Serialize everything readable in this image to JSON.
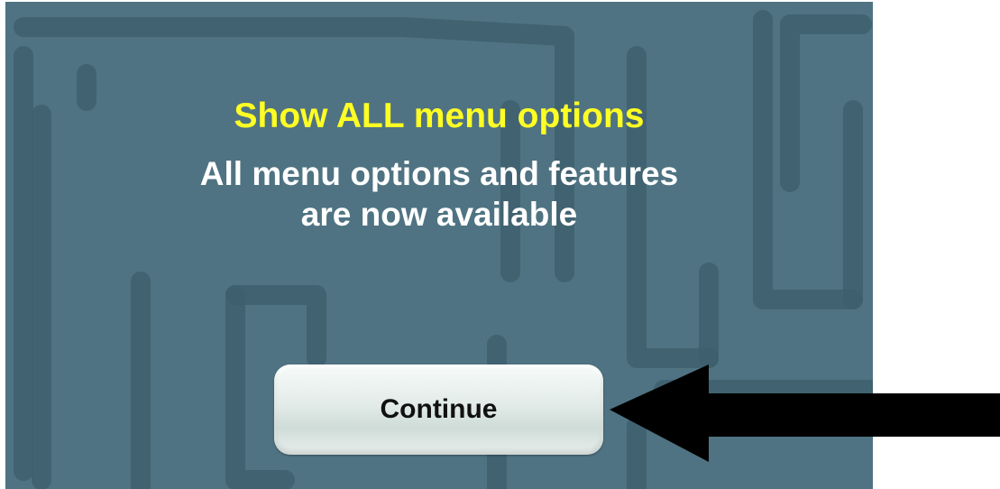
{
  "dialog": {
    "title": "Show ALL menu options",
    "message_line1": "All menu options and features",
    "message_line2": "are now available",
    "continue_label": "Continue"
  },
  "colors": {
    "background": "#4f7382",
    "maze_lines": "#3e5f6d",
    "title": "#ffff24",
    "message": "#ffffff",
    "arrow": "#000000"
  },
  "icons": {
    "pointer": "left-arrow-icon"
  }
}
